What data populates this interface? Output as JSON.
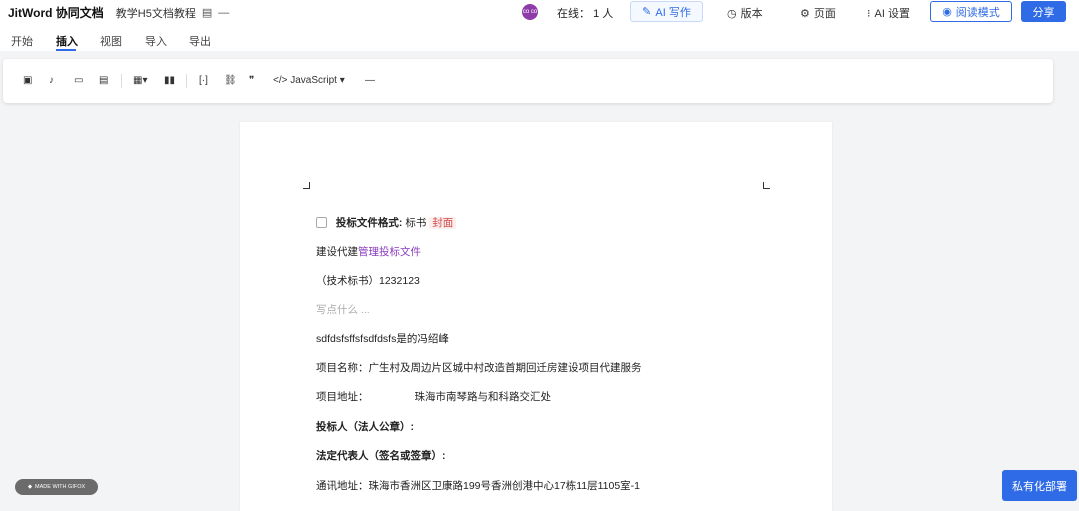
{
  "header": {
    "brand": "JitWord 协同文档",
    "doc_title": "教学H5文档教程",
    "online_label": "在线：",
    "online_count": "1 人",
    "avatar_text": "co co",
    "ai_write_label": "AI 写作",
    "version_label": "版本",
    "page_label": "页面",
    "ai_settings_label": "AI 设置",
    "read_mode_label": "阅读模式",
    "share_label": "分享"
  },
  "tabs": [
    {
      "label": "开始"
    },
    {
      "label": "插入"
    },
    {
      "label": "视图"
    },
    {
      "label": "导入"
    },
    {
      "label": "导出"
    }
  ],
  "toolbar": {
    "code_language": "JavaScript"
  },
  "document": {
    "line1": {
      "label": "投标文件格式:",
      "value": "标书",
      "tag": "封面"
    },
    "line2": {
      "prefix": "建设代建",
      "link": "管理投标文件"
    },
    "line3": "（技术标书）1232123",
    "line4_placeholder": "写点什么 ...",
    "line5": "sdfdsfsffsfsdfdsfs是的冯绍峰",
    "line6": "项目名称：广生村及周边片区城中村改造首期回迁房建设项目代建服务",
    "line7": {
      "label": "项目地址：",
      "value": "珠海市南琴路与和科路交汇处"
    },
    "line8": "投标人（法人公章）:",
    "line9": "法定代表人（签名或签章）:",
    "line10": "通讯地址：珠海市香洲区卫康路199号香洲创港中心17栋11层1105室-1"
  },
  "watermark": "MADE WITH GIFOX",
  "deploy_button": "私有化部署"
}
